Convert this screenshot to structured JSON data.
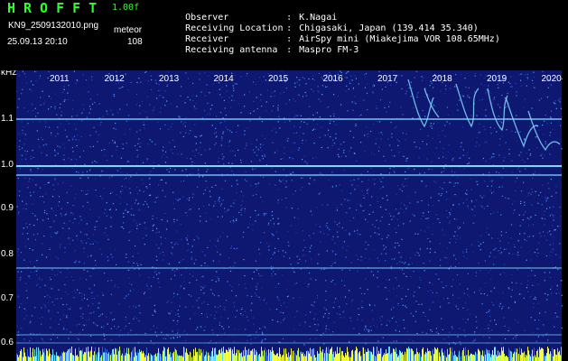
{
  "header": {
    "app_title": "HROFFT",
    "version": "1.00f",
    "filename": "KN9_2509132010.png",
    "mode": "meteor",
    "datetime": "25.09.13 20:10",
    "count": "108"
  },
  "info": [
    {
      "label": "Observer",
      "value": "K.Nagai"
    },
    {
      "label": "Receiving Location",
      "value": "Chigasaki, Japan (139.414 35.340)"
    },
    {
      "label": "Receiver",
      "value": "AirSpy mini (Miakejima VOR 108.65MHz)"
    },
    {
      "label": "Receiving antenna",
      "value": "Maspro FM-3"
    }
  ],
  "axis": {
    "y_unit": "kHz",
    "y_ticks": [
      "1.1",
      "1.0",
      "0.9",
      "0.8",
      "0.7",
      "0.6"
    ],
    "x_ticks": [
      "2011",
      "2012",
      "2013",
      "2014",
      "2015",
      "2016",
      "2017",
      "2018",
      "2019",
      "2020"
    ]
  },
  "colors": {
    "background": "#101a7a",
    "signal": "#7fd8ff",
    "title": "#2cff2c",
    "bottom_noise": "#f7ff3a"
  }
}
